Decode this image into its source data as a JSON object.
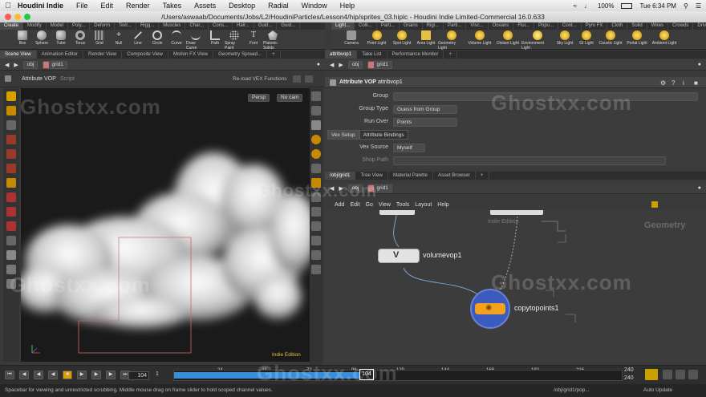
{
  "menubar": {
    "app_name": "Houdini Indie",
    "items": [
      "File",
      "Edit",
      "Render",
      "Takes",
      "Assets",
      "Desktop",
      "Radial",
      "Window",
      "Help"
    ],
    "battery": "100%",
    "clock": "Tue 6:34 PM"
  },
  "window": {
    "title": "/Users/aswaab/Documents/Jobs/L2/HoudiniParticles/Lesson4/hip/sprites_03.hiplc - Houdini Indie Limited-Commercial 16.0.633"
  },
  "shelf_left": {
    "tabs": [
      "Create",
      "Modify",
      "Model",
      "Poly...",
      "Deform",
      "Text...",
      "Rigg...",
      "Muscles",
      "Char...",
      "Cons...",
      "Hair...",
      "Guid...",
      "Guid..."
    ],
    "tools": [
      "Box",
      "Sphere",
      "Tube",
      "Torus",
      "Grid",
      "Null",
      "Line",
      "Circle",
      "Curve",
      "Draw Curve",
      "Path",
      "Spray Paint",
      "Font",
      "Platonic Solids"
    ]
  },
  "shelf_right": {
    "tabs": [
      "Light...",
      "Colli...",
      "Parti...",
      "Grains",
      "Rigi...",
      "Parti...",
      "Visc...",
      "Oceans",
      "Flui...",
      "Popu...",
      "Cont...",
      "Pyro FX",
      "Cloth",
      "Solid",
      "Wires",
      "Crowds",
      "Driv..."
    ],
    "tools": [
      "Camera",
      "Point Light",
      "Spot Light",
      "Area Light",
      "Geometry Light",
      "Volume Light",
      "Distant Light",
      "Environment Light",
      "Sky Light",
      "GI Light",
      "Caustic Light",
      "Portal Light",
      "Ambient Light"
    ]
  },
  "left_pane": {
    "tabs": [
      "Scene View",
      "Animation Editor",
      "Render View",
      "Composite View",
      "Motion FX View",
      "Geometry Spread..."
    ],
    "path": [
      "obj",
      "grid1"
    ],
    "header_title": "Attribute VOP",
    "header_script": "Script",
    "reload_label": "Re-load VEX Functions",
    "persp_label": "Persp",
    "cam_label": "No cam",
    "edition_label": "Indie Edition"
  },
  "right_top_pane": {
    "tabs": [
      "attribvop1",
      "Take List",
      "Performance Monitor"
    ],
    "path": [
      "obj",
      "grid1"
    ],
    "node_type": "Attribute VOP",
    "node_name": "attribvop1",
    "params": [
      {
        "label": "Group",
        "value": ""
      },
      {
        "label": "Group Type",
        "value": "Guess from Group"
      },
      {
        "label": "Run Over",
        "value": "Points"
      }
    ],
    "subtabs": [
      "Vex Setup",
      "Attribute Bindings"
    ],
    "vex_source_label": "Vex Source",
    "vex_source_value": "Myself",
    "shop_path_label": "Shop Path"
  },
  "network_pane": {
    "tabs": [
      "/obj/grid1",
      "Tree View",
      "Material Palette",
      "Asset Browser"
    ],
    "path": [
      "obj",
      "grid1"
    ],
    "menu": [
      "Add",
      "Edit",
      "Go",
      "View",
      "Tools",
      "Layout",
      "Help"
    ],
    "context_label": "Geometry",
    "edition_label": "Indie Edition",
    "nodes": [
      "volumevop1",
      "copytopoints1"
    ]
  },
  "timeline": {
    "current_frame": "104",
    "start_frame": "1",
    "ticks": [
      "24",
      "48",
      "72",
      "96",
      "120",
      "144",
      "168",
      "192",
      "216"
    ],
    "range_end_1": "240",
    "range_end_2": "240",
    "frame_marker": "104",
    "play_progress": 0.43
  },
  "statusbar": {
    "message": "Spacebar for viewing and unrestricted scrubbing. Middle mouse drag on frame slider to hold scoped channel values.",
    "path": "/obj/grid1/pop...",
    "update_mode": "Auto Update"
  },
  "watermark": "Ghostxx.com",
  "colors": {
    "accent_yellow": "#f0b400",
    "timeline_blue": "#3a8ed8",
    "node_blue": "#3c5bbf",
    "node_orange": "#f2a21c"
  }
}
